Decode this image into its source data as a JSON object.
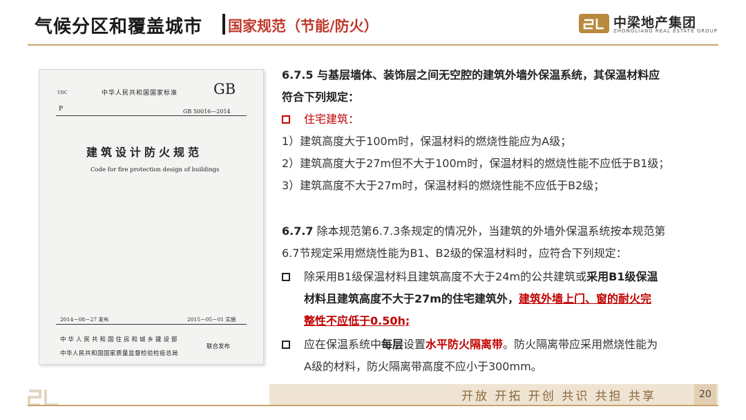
{
  "header": {
    "title": "气候分区和覆盖城市",
    "subtitle": "国家规范（节能/防火）",
    "logo_cn": "中梁地产集团",
    "logo_en": "ZHONGLIANG REAL ESTATE GROUP"
  },
  "document": {
    "udc": "UDC",
    "standard_label": "中华人民共和国国家标准",
    "gb": "GB",
    "category": "P",
    "number": "GB 50016—2014",
    "title_cn": "建筑设计防火规范",
    "title_en": "Code for fire protection design of buildings",
    "issue_date": "2014－08－27 发布",
    "impl_date": "2015－05－01 实施",
    "publisher1": "中华人民共和国住房和城乡建设部",
    "publisher2": "中华人民共和国国家质量监督检验检疫总局",
    "joint": "联合发布"
  },
  "content": {
    "s675_line1": "6.7.5 与基层墙体、装饰层之间无空腔的建筑外墙外保温系统，其保温材料应",
    "s675_line2": "符合下列规定：",
    "residential": "住宅建筑：",
    "item1": "1）建筑高度大于100m时，保温材料的燃烧性能应为A级；",
    "item2": "2）建筑高度大于27m但不大于100m时，保温材料的燃烧性能不应低于B1级；",
    "item3": "3）建筑高度不大于27m时，保温材料的燃烧性能不应低于B2级；",
    "s677_num": "6.7.7",
    "s677_line1": " 除本规范第6.7.3条规定的情况外，当建筑的外墙外保温系统按本规范第",
    "s677_line2": "6.7节规定采用燃烧性能为B1、B2级的保温材料时，应符合下列规定：",
    "b1_a": "除采用B1级保温材料且建筑高度不大于24m的公共建筑或",
    "b1_b": "采用B1级保温",
    "b1_c": "材料且建筑高度不大于27m的住宅建筑外，",
    "b1_d": "建筑外墙上门、窗的耐火完",
    "b1_e": "整性不应低于0.50h;",
    "b2_a": "应在保温系统中",
    "b2_b": "每层",
    "b2_c": "设置",
    "b2_d": "水平防火隔离带",
    "b2_e": "。防火隔离带应采用燃烧性能为",
    "b2_f": "A级的材料，防火隔离带高度不应小于300mm。"
  },
  "footer": {
    "slogan": "开放 开拓 开创 共识 共担 共享",
    "page": "20"
  },
  "colors": {
    "accent_red": "#c00000",
    "gold": "#c9a46a"
  }
}
